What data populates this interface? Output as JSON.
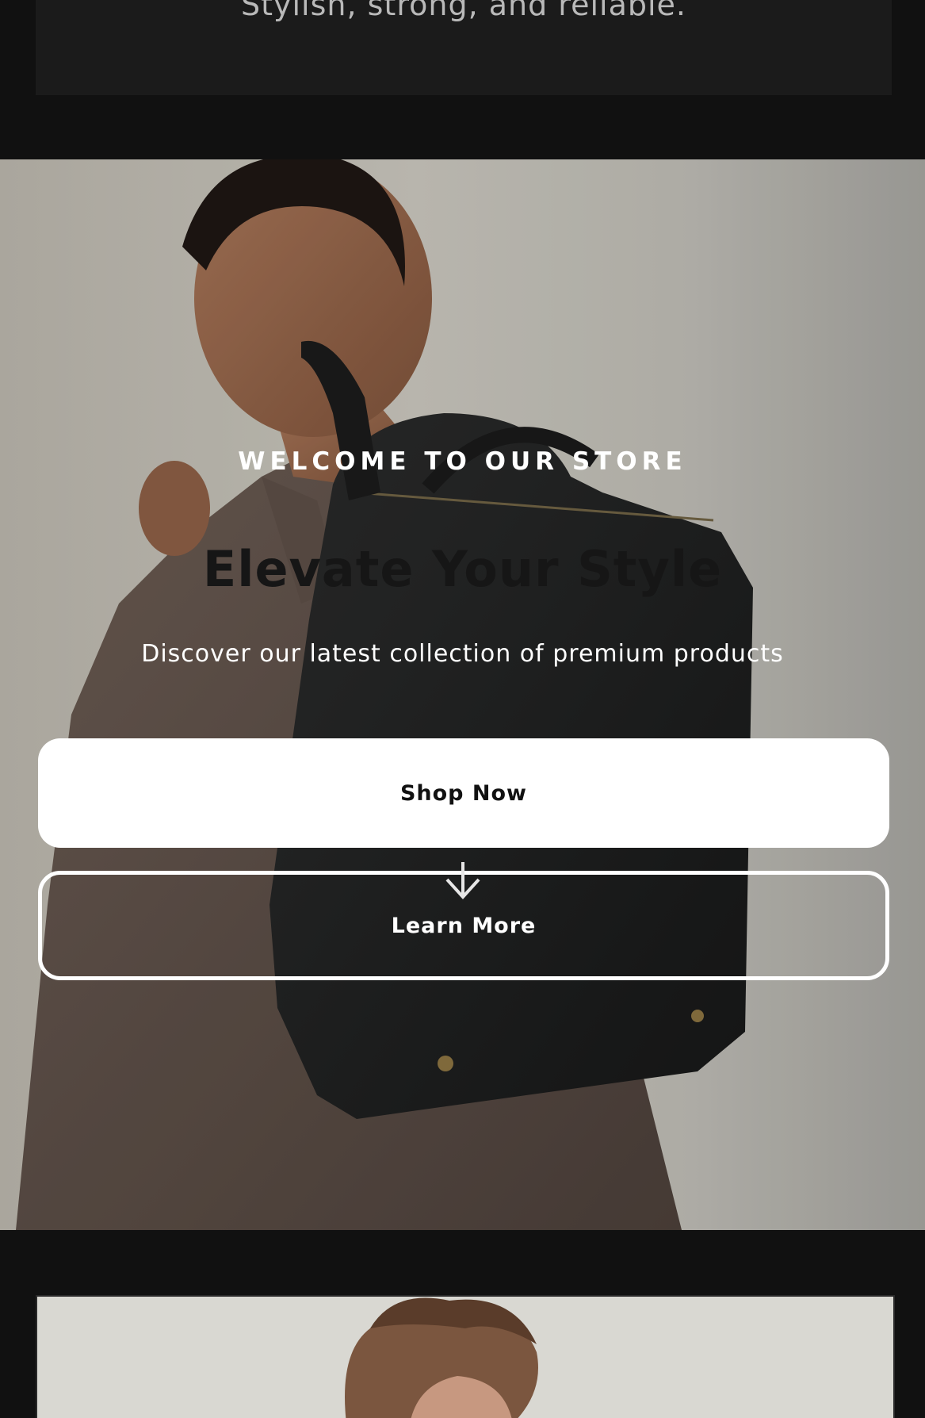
{
  "testimonial": {
    "quote": "“Stylish, strong, and reliable.”"
  },
  "hero": {
    "eyebrow": "WELCOME TO OUR STORE",
    "title": "Elevate Your Style",
    "subtitle": "Discover our latest collection of premium products",
    "primary_button": "Shop Now",
    "secondary_button": "Learn More",
    "scroll_icon": "arrow-down-icon"
  },
  "colors": {
    "page_background": "#111111",
    "card_background": "#1b1b1b",
    "primary_button_bg": "#ffffff",
    "title_text": "#161616"
  }
}
